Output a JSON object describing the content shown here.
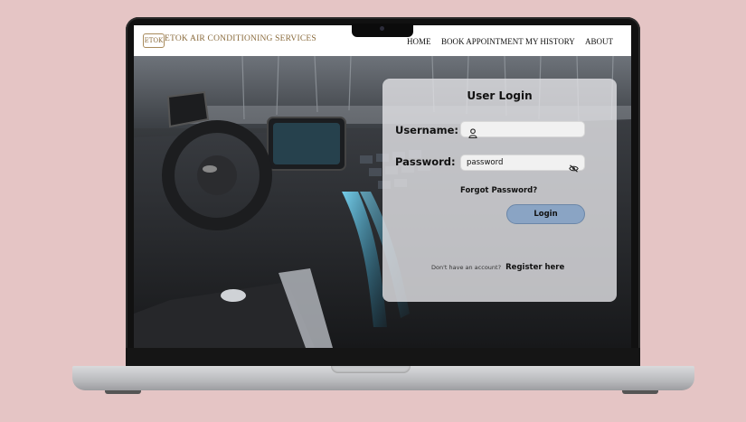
{
  "site": {
    "logo_text": "ETOK",
    "brand_name": "ETOK AIR CONDITIONING SERVICES"
  },
  "nav": {
    "home": "HOME",
    "book": "BOOK APPOINTMENT",
    "history": "MY HISTORY",
    "about": "ABOUT"
  },
  "login": {
    "title": "User Login",
    "username_label": "Username:",
    "username_value": "",
    "password_label": "Password:",
    "password_value": "password",
    "forgot": "Forgot Password?",
    "button": "Login",
    "register_prompt": "Don't have an account?",
    "register_link": "Register here"
  },
  "icons": {
    "username": "user-icon",
    "password_toggle": "eye-slash-icon"
  },
  "colors": {
    "background": "#e5c5c5",
    "brand": "#8a6b3c",
    "login_button": "#8aa4c4"
  }
}
